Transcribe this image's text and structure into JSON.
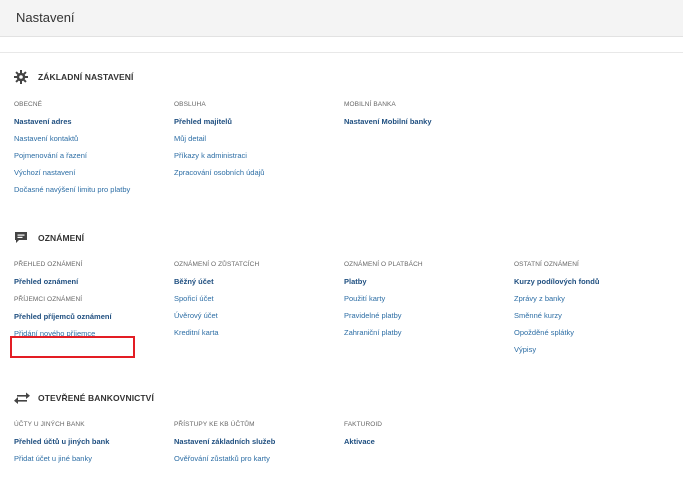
{
  "header": {
    "title": "Nastavení"
  },
  "sections": {
    "basic": {
      "title": "ZÁKLADNÍ NASTAVENÍ",
      "cols": [
        {
          "cat": "OBECNÉ",
          "items": [
            "Nastavení adres",
            "Nastavení kontaktů",
            "Pojmenování a řazení",
            "Výchozí nastavení",
            "Dočasné navýšení limitu pro platby"
          ]
        },
        {
          "cat": "OBSLUHA",
          "items": [
            "Přehled majitelů",
            "Můj detail",
            "Příkazy k administraci",
            "Zpracování osobních údajů"
          ]
        },
        {
          "cat": "MOBILNÍ BANKA",
          "items": [
            "Nastavení Mobilní banky"
          ]
        }
      ]
    },
    "notifications": {
      "title": "OZNÁMENÍ",
      "cols": [
        {
          "cat": "PŘEHLED OZNÁMENÍ",
          "items": [
            "Přehled oznámení"
          ],
          "cat2": "PŘÍJEMCI OZNÁMENÍ",
          "items2": [
            "Přehled příjemců oznámení",
            "Přidání nového příjemce"
          ]
        },
        {
          "cat": "OZNÁMENÍ O ZŮSTATCÍCH",
          "items": [
            "Běžný účet",
            "Spořicí účet",
            "Úvěrový účet",
            "Kreditní karta"
          ]
        },
        {
          "cat": "OZNÁMENÍ O PLATBÁCH",
          "items": [
            "Platby",
            "Použití karty",
            "Pravidelné platby",
            "Zahraniční platby"
          ]
        },
        {
          "cat": "OSTATNÍ OZNÁMENÍ",
          "items": [
            "Kurzy podílových fondů",
            "Zprávy z banky",
            "Směnné kurzy",
            "Opožděné splátky",
            "Výpisy"
          ]
        }
      ]
    },
    "openbanking": {
      "title": "OTEVŘENÉ BANKOVNICTVÍ",
      "cols": [
        {
          "cat": "ÚČTY U JINÝCH BANK",
          "items": [
            "Přehled účtů u jiných bank",
            "Přidat účet u jiné banky"
          ]
        },
        {
          "cat": "PŘÍSTUPY KE KB ÚČTŮM",
          "items": [
            "Nastavení základních služeb",
            "Ověřování zůstatků pro karty"
          ]
        },
        {
          "cat": "FAKTUROID",
          "items": [
            "Aktivace"
          ]
        }
      ]
    }
  },
  "colors": {
    "link": "#2d6ea5",
    "link_bold": "#1f4f80",
    "highlight": "#e31d24"
  },
  "icons": {
    "basic": "gear-icon",
    "notifications": "chat-bubble-icon",
    "openbanking": "transfer-arrows-icon"
  }
}
